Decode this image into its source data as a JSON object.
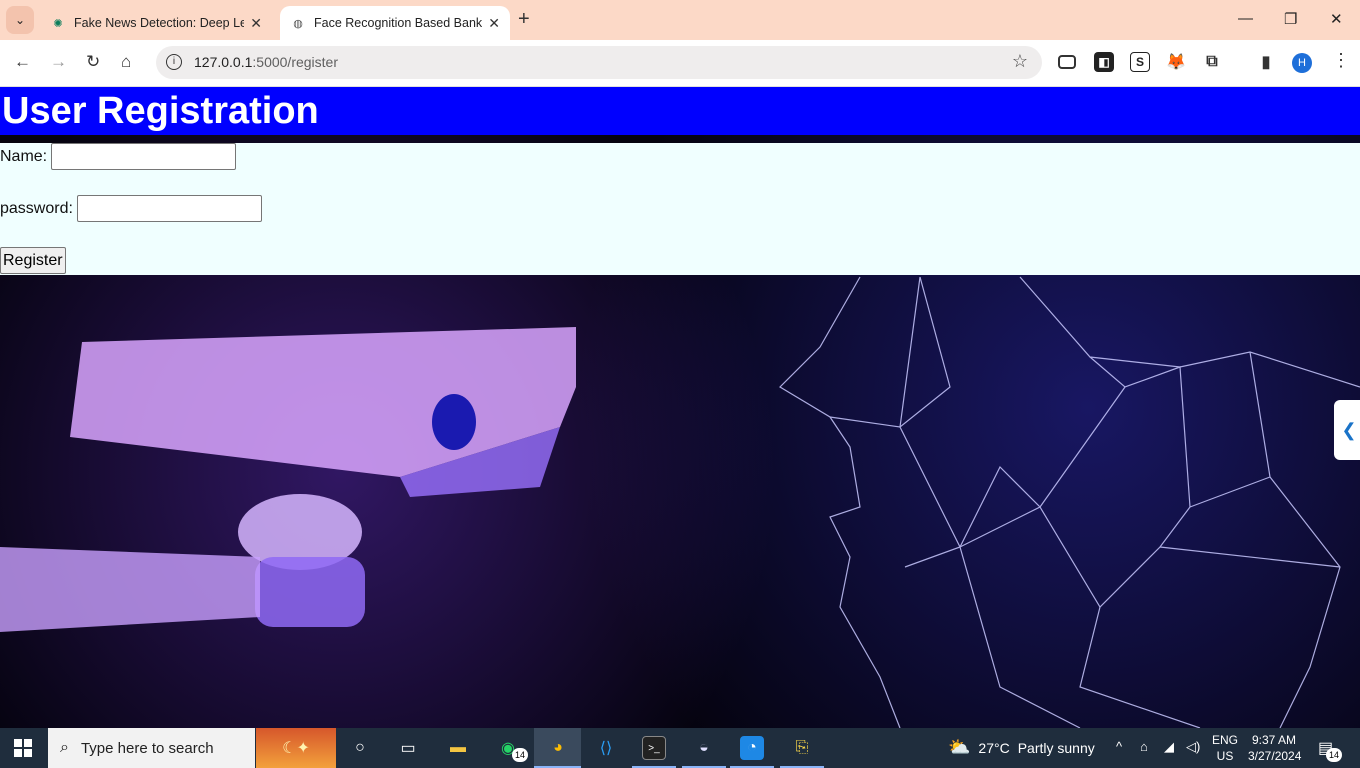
{
  "browser": {
    "tabs": [
      {
        "title": "Fake News Detection: Deep Lea",
        "active": false,
        "favicon": "openai-icon"
      },
      {
        "title": "Face Recognition Based Banking",
        "active": true,
        "favicon": "globe-icon"
      }
    ],
    "url_host": "127.0.0.1",
    "url_rest": ":5000/register",
    "profile_initial": "H"
  },
  "page": {
    "heading": "User Registration",
    "name_label": "Name:",
    "password_label": "password:",
    "register_label": "Register",
    "header_color": "#0000ff",
    "form_bg": "#f0ffff"
  },
  "taskbar": {
    "search_placeholder": "Type here to search",
    "whatsapp_badge": "14",
    "weather_temp": "27°C",
    "weather_text": "Partly sunny",
    "lang_line1": "ENG",
    "lang_line2": "US",
    "time": "9:37 AM",
    "date": "3/27/2024",
    "notification_count": "14"
  }
}
